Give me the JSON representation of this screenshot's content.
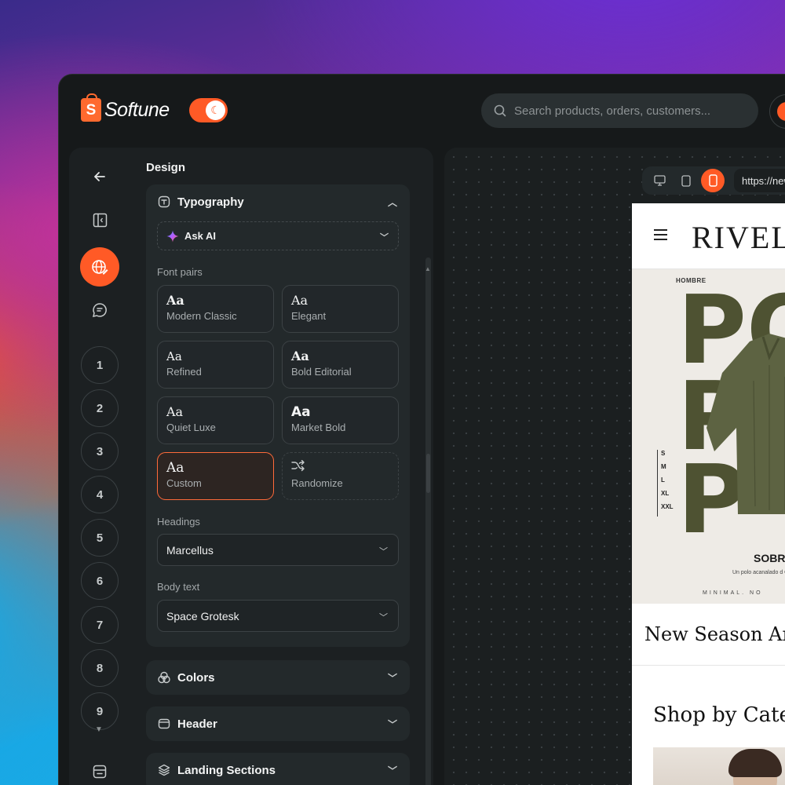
{
  "app": {
    "logo_text": "Softune",
    "logo_glyph": "S",
    "theme_toggle_icon": "moon-icon",
    "brand_color": "#ff5a26"
  },
  "search": {
    "placeholder": "Search products, orders, customers..."
  },
  "panel": {
    "title": "Design",
    "rail_icons": [
      "arrow-left-icon",
      "sidebar-toggle-icon",
      "globe-edit-icon",
      "chat-bubble-icon",
      "folder-icon"
    ],
    "steps": [
      "1",
      "2",
      "3",
      "4",
      "5",
      "6",
      "7",
      "8",
      "9"
    ]
  },
  "typography": {
    "title": "Typography",
    "ask_ai_label": "Ask AI",
    "font_pairs_label": "Font pairs",
    "pairs": [
      {
        "sample": "Aa",
        "name": "Modern Classic"
      },
      {
        "sample": "Aa",
        "name": "Elegant"
      },
      {
        "sample": "Aa",
        "name": "Refined"
      },
      {
        "sample": "Aa",
        "name": "Bold Editorial"
      },
      {
        "sample": "Aa",
        "name": "Quiet Luxe"
      },
      {
        "sample": "Aa",
        "name": "Market Bold"
      },
      {
        "sample": "Aa",
        "name": "Custom"
      }
    ],
    "randomize_label": "Randomize",
    "selected_pair": "Custom",
    "headings_label": "Headings",
    "headings_value": "Marcellus",
    "body_label": "Body text",
    "body_value": "Space Grotesk"
  },
  "sections": {
    "colors": "Colors",
    "header": "Header",
    "landing": "Landing Sections"
  },
  "preview": {
    "url": "https://new",
    "active_device": "mobile",
    "site": {
      "brand": "RIVELLE",
      "hero_tag": "HOMBRE",
      "hero_letters": [
        "PO",
        "P",
        "P"
      ],
      "sizes": [
        "S",
        "M",
        "L",
        "XL",
        "XXL"
      ],
      "hero_title": "SOBRE E",
      "hero_desc": "Un polo acanalado d Cómodo, minim",
      "hero_footer": "MINIMAL.     NO",
      "new_season": "New Season Ar",
      "shop_by_category": "Shop by Catego"
    }
  }
}
